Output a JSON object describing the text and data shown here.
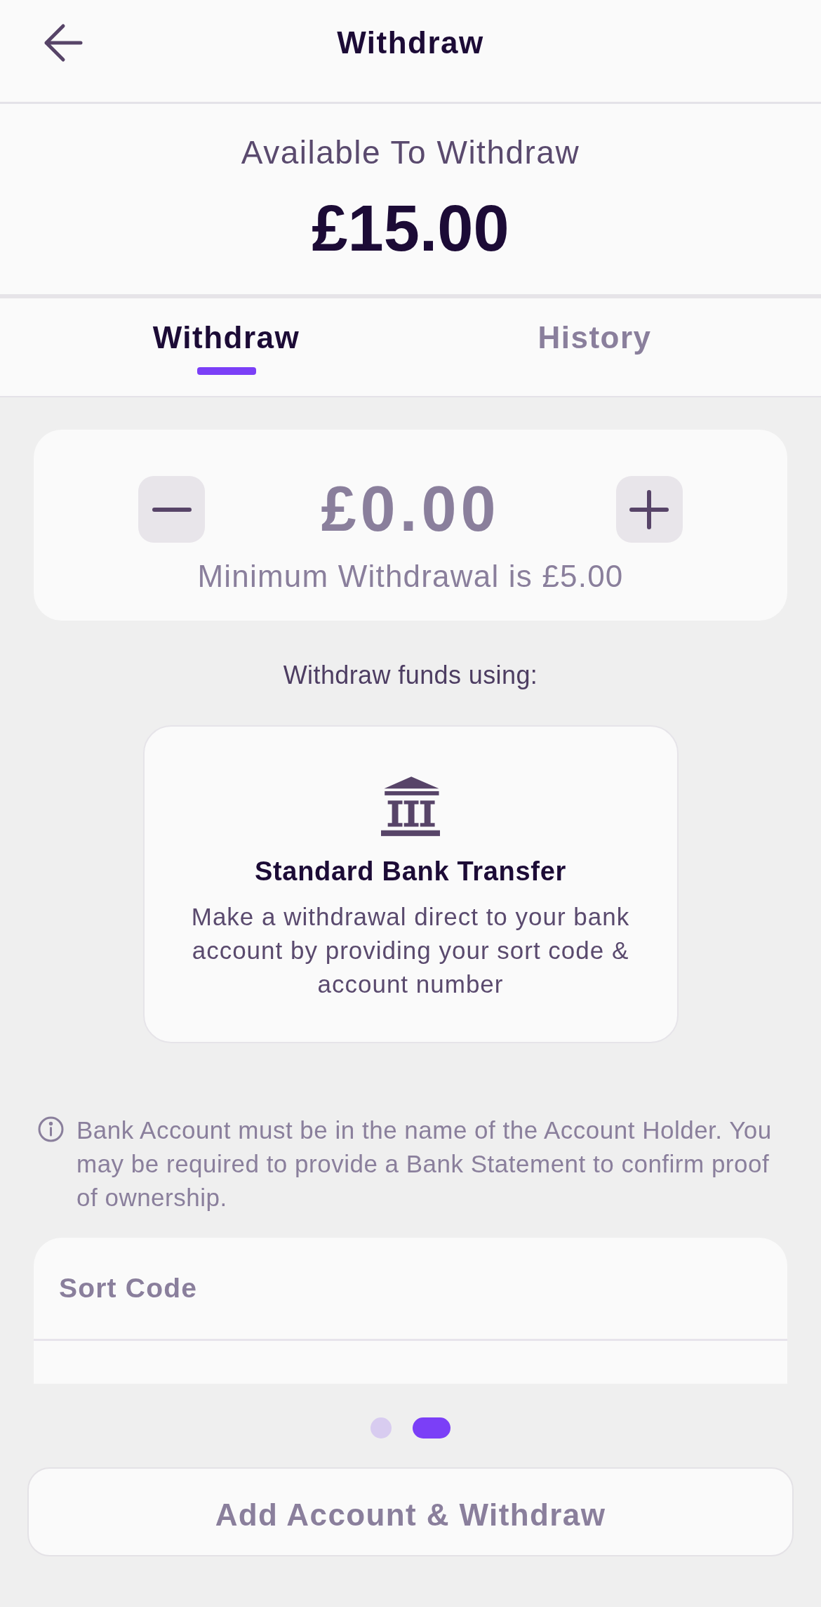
{
  "header": {
    "title": "Withdraw"
  },
  "balance": {
    "label": "Available To Withdraw",
    "amount": "£15.00"
  },
  "tabs": [
    {
      "label": "Withdraw",
      "selected": true
    },
    {
      "label": "History",
      "selected": false
    }
  ],
  "amount_card": {
    "value": "£0.00",
    "hint": "Minimum Withdrawal is £5.00"
  },
  "methods_heading": "Withdraw funds using:",
  "methods": [
    {
      "title": "Standard Bank Transfer",
      "description": "Make a withdrawal direct to your bank account by providing your sort code & account number"
    }
  ],
  "notice": "Bank Account must be in the name of the Account Holder. You may be required to provide a Bank Statement to confirm proof of ownership.",
  "fields": [
    {
      "kind": "full",
      "placeholder": "Sort Code"
    },
    {
      "kind": "partial"
    }
  ],
  "pager": [
    {
      "selected": false
    },
    {
      "selected": true
    }
  ],
  "submit_button": {
    "label": "Add Account & Withdraw",
    "disabled": true
  }
}
